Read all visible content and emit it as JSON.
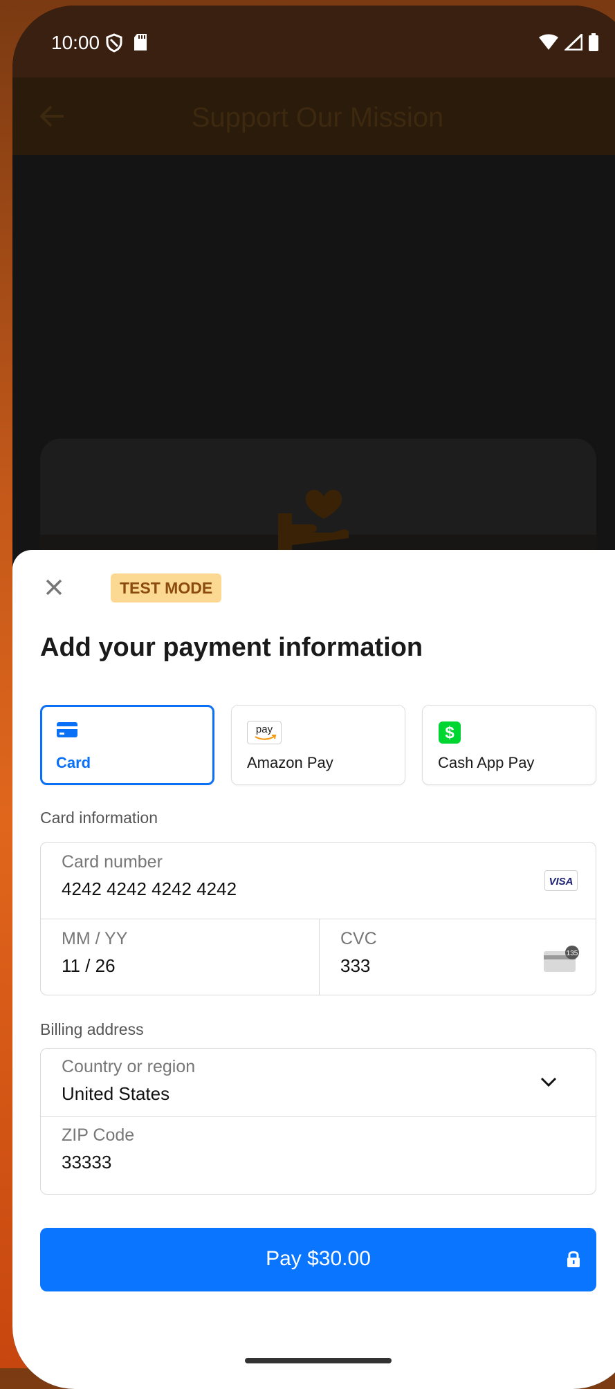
{
  "status_bar": {
    "time": "10:00",
    "left_icons": [
      "shield-icon",
      "sd-card-icon"
    ],
    "right_icons": [
      "wifi-icon",
      "signal-icon",
      "battery-icon"
    ]
  },
  "app_bar": {
    "title": "Support Our Mission",
    "back_icon": "back-arrow-icon"
  },
  "sheet": {
    "badge": "TEST MODE",
    "title": "Add your payment information",
    "methods": [
      {
        "label": "Card",
        "icon": "card-icon",
        "selected": true
      },
      {
        "label": "Amazon Pay",
        "icon": "amazon-pay-icon",
        "selected": false
      },
      {
        "label": "Cash App Pay",
        "icon": "cash-app-icon",
        "selected": false
      }
    ],
    "card_section_label": "Card information",
    "card_number": {
      "label": "Card number",
      "value": "4242 4242 4242 4242",
      "brand": "VISA"
    },
    "expiry": {
      "label": "MM / YY",
      "value": "11 / 26"
    },
    "cvc": {
      "label": "CVC",
      "value": "333",
      "cvc_badge": "135"
    },
    "billing_section_label": "Billing address",
    "country": {
      "label": "Country or region",
      "value": "United States"
    },
    "zip": {
      "label": "ZIP Code",
      "value": "33333"
    },
    "pay_button": {
      "label": "Pay $30.00"
    },
    "amazon_pay_text": "pay",
    "cash_app_symbol": "$"
  },
  "colors": {
    "accent": "#0a75ff",
    "badge_bg": "#fbd993",
    "badge_text": "#8a4b0d",
    "cash_app_green": "#00d632"
  }
}
